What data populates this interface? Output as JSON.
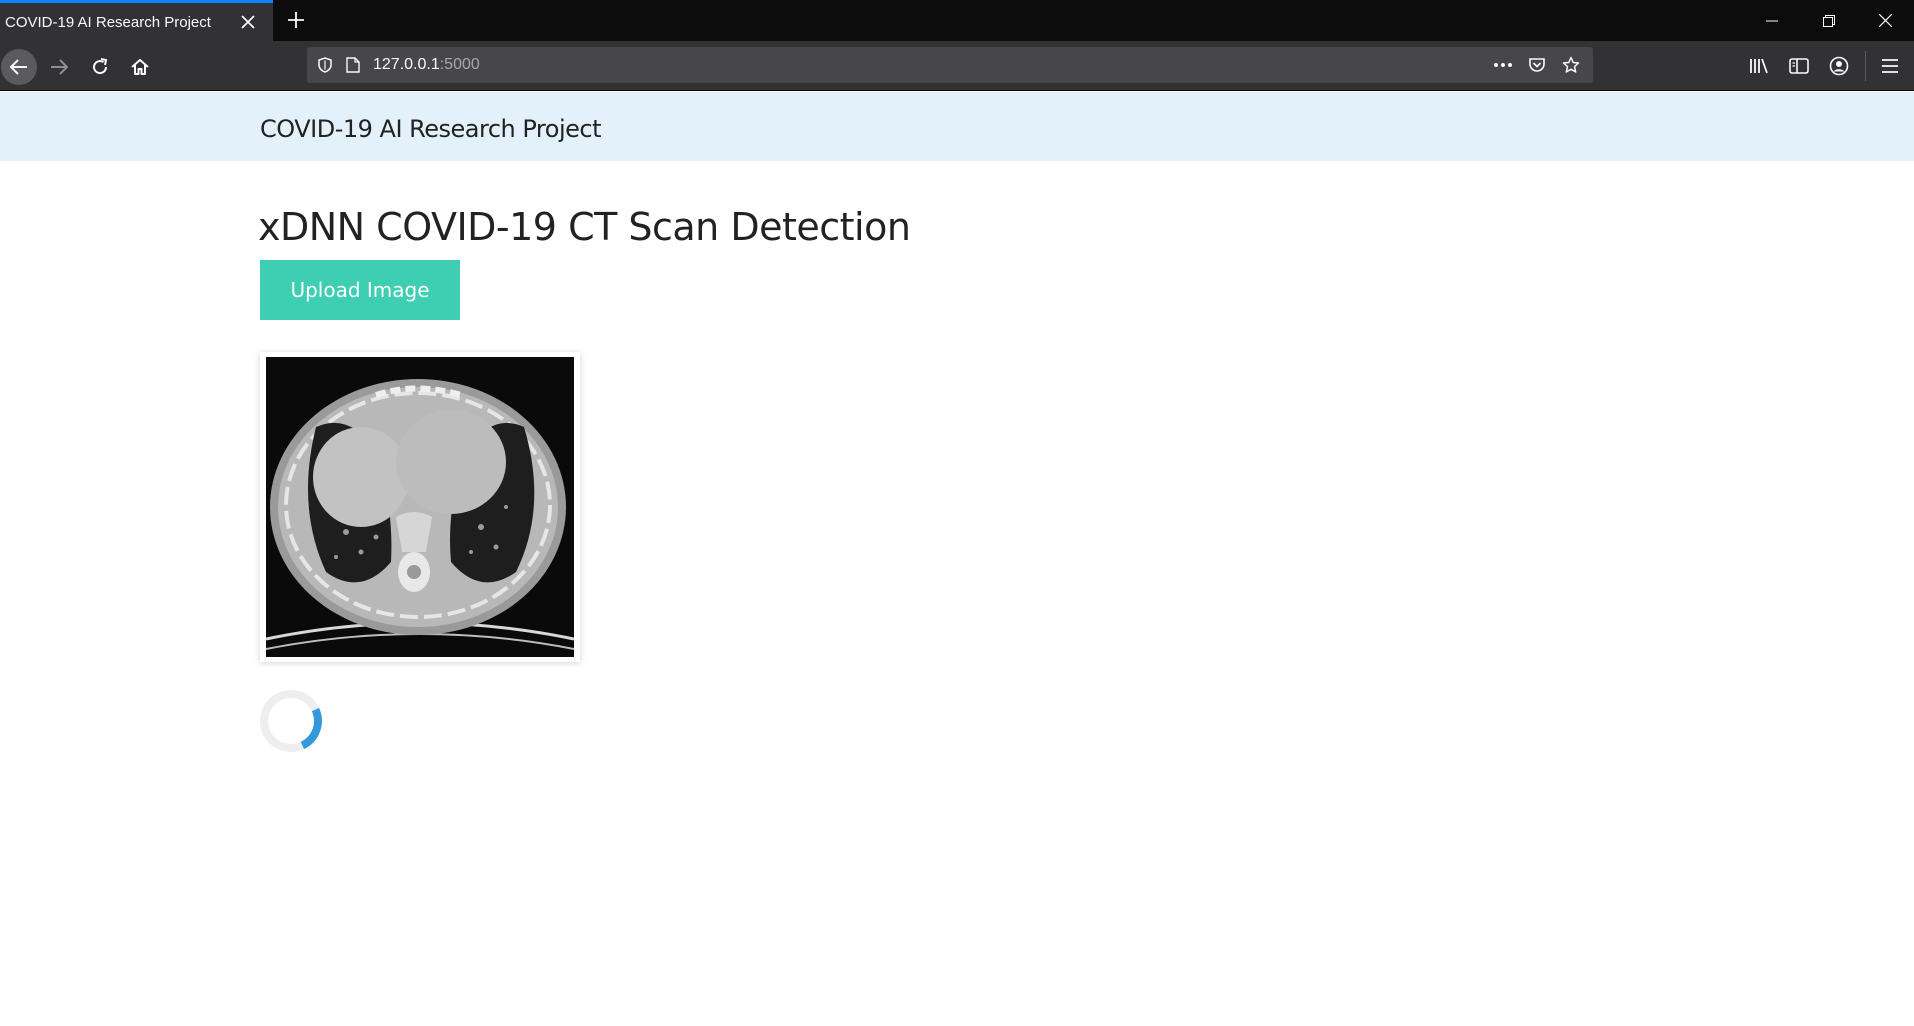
{
  "browser": {
    "tab_title": "COVID-19 AI Research Project",
    "url_host": "127.0.0.1",
    "url_port": ":5000",
    "icons": [
      "close-icon",
      "plus-icon",
      "minimize-icon",
      "restore-icon",
      "window-close-icon",
      "back-icon",
      "forward-icon",
      "reload-icon",
      "home-icon",
      "shield-icon",
      "page-icon",
      "more-icon",
      "pocket-icon",
      "star-icon",
      "library-icon",
      "sidebar-icon",
      "account-icon",
      "menu-icon"
    ]
  },
  "site": {
    "brand": "COVID-19 AI Research Project",
    "heading": "xDNN COVID-19 CT Scan Detection",
    "upload_label": "Upload Image"
  },
  "colors": {
    "navbar_bg": "#e3f1fb",
    "button_bg": "#3ecfb2",
    "spinner": "#3498db"
  }
}
